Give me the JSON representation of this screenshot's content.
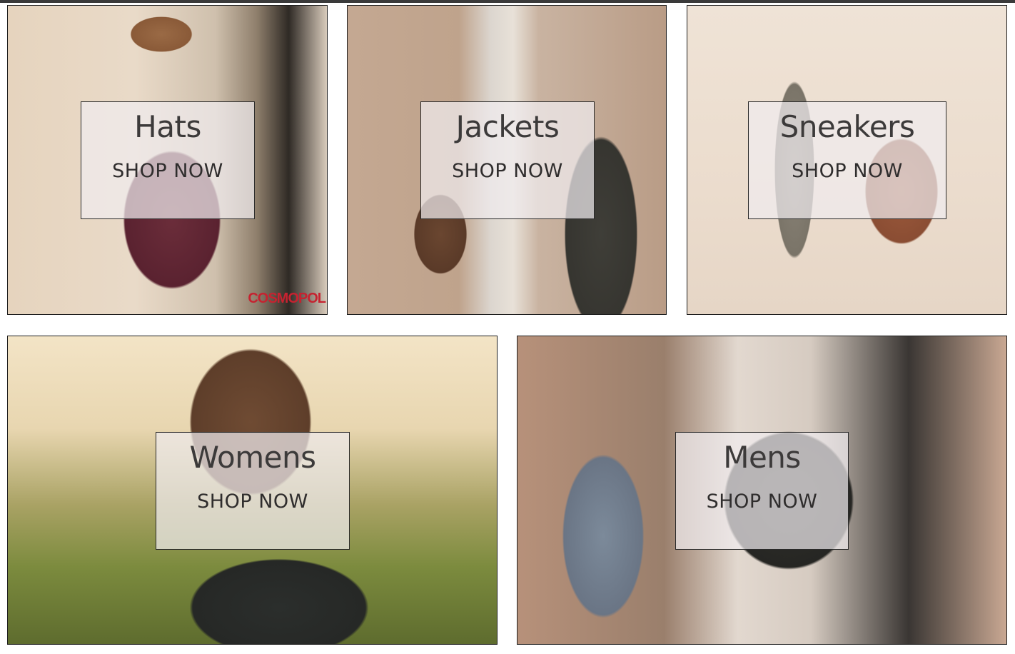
{
  "categories": [
    {
      "id": "hats",
      "title": "Hats",
      "cta": "SHOP NOW"
    },
    {
      "id": "jackets",
      "title": "Jackets",
      "cta": "SHOP NOW"
    },
    {
      "id": "sneakers",
      "title": "Sneakers",
      "cta": "SHOP NOW"
    },
    {
      "id": "womens",
      "title": "Womens",
      "cta": "SHOP NOW"
    },
    {
      "id": "mens",
      "title": "Mens",
      "cta": "SHOP NOW"
    }
  ],
  "photo_watermark": "COSMOPOL"
}
